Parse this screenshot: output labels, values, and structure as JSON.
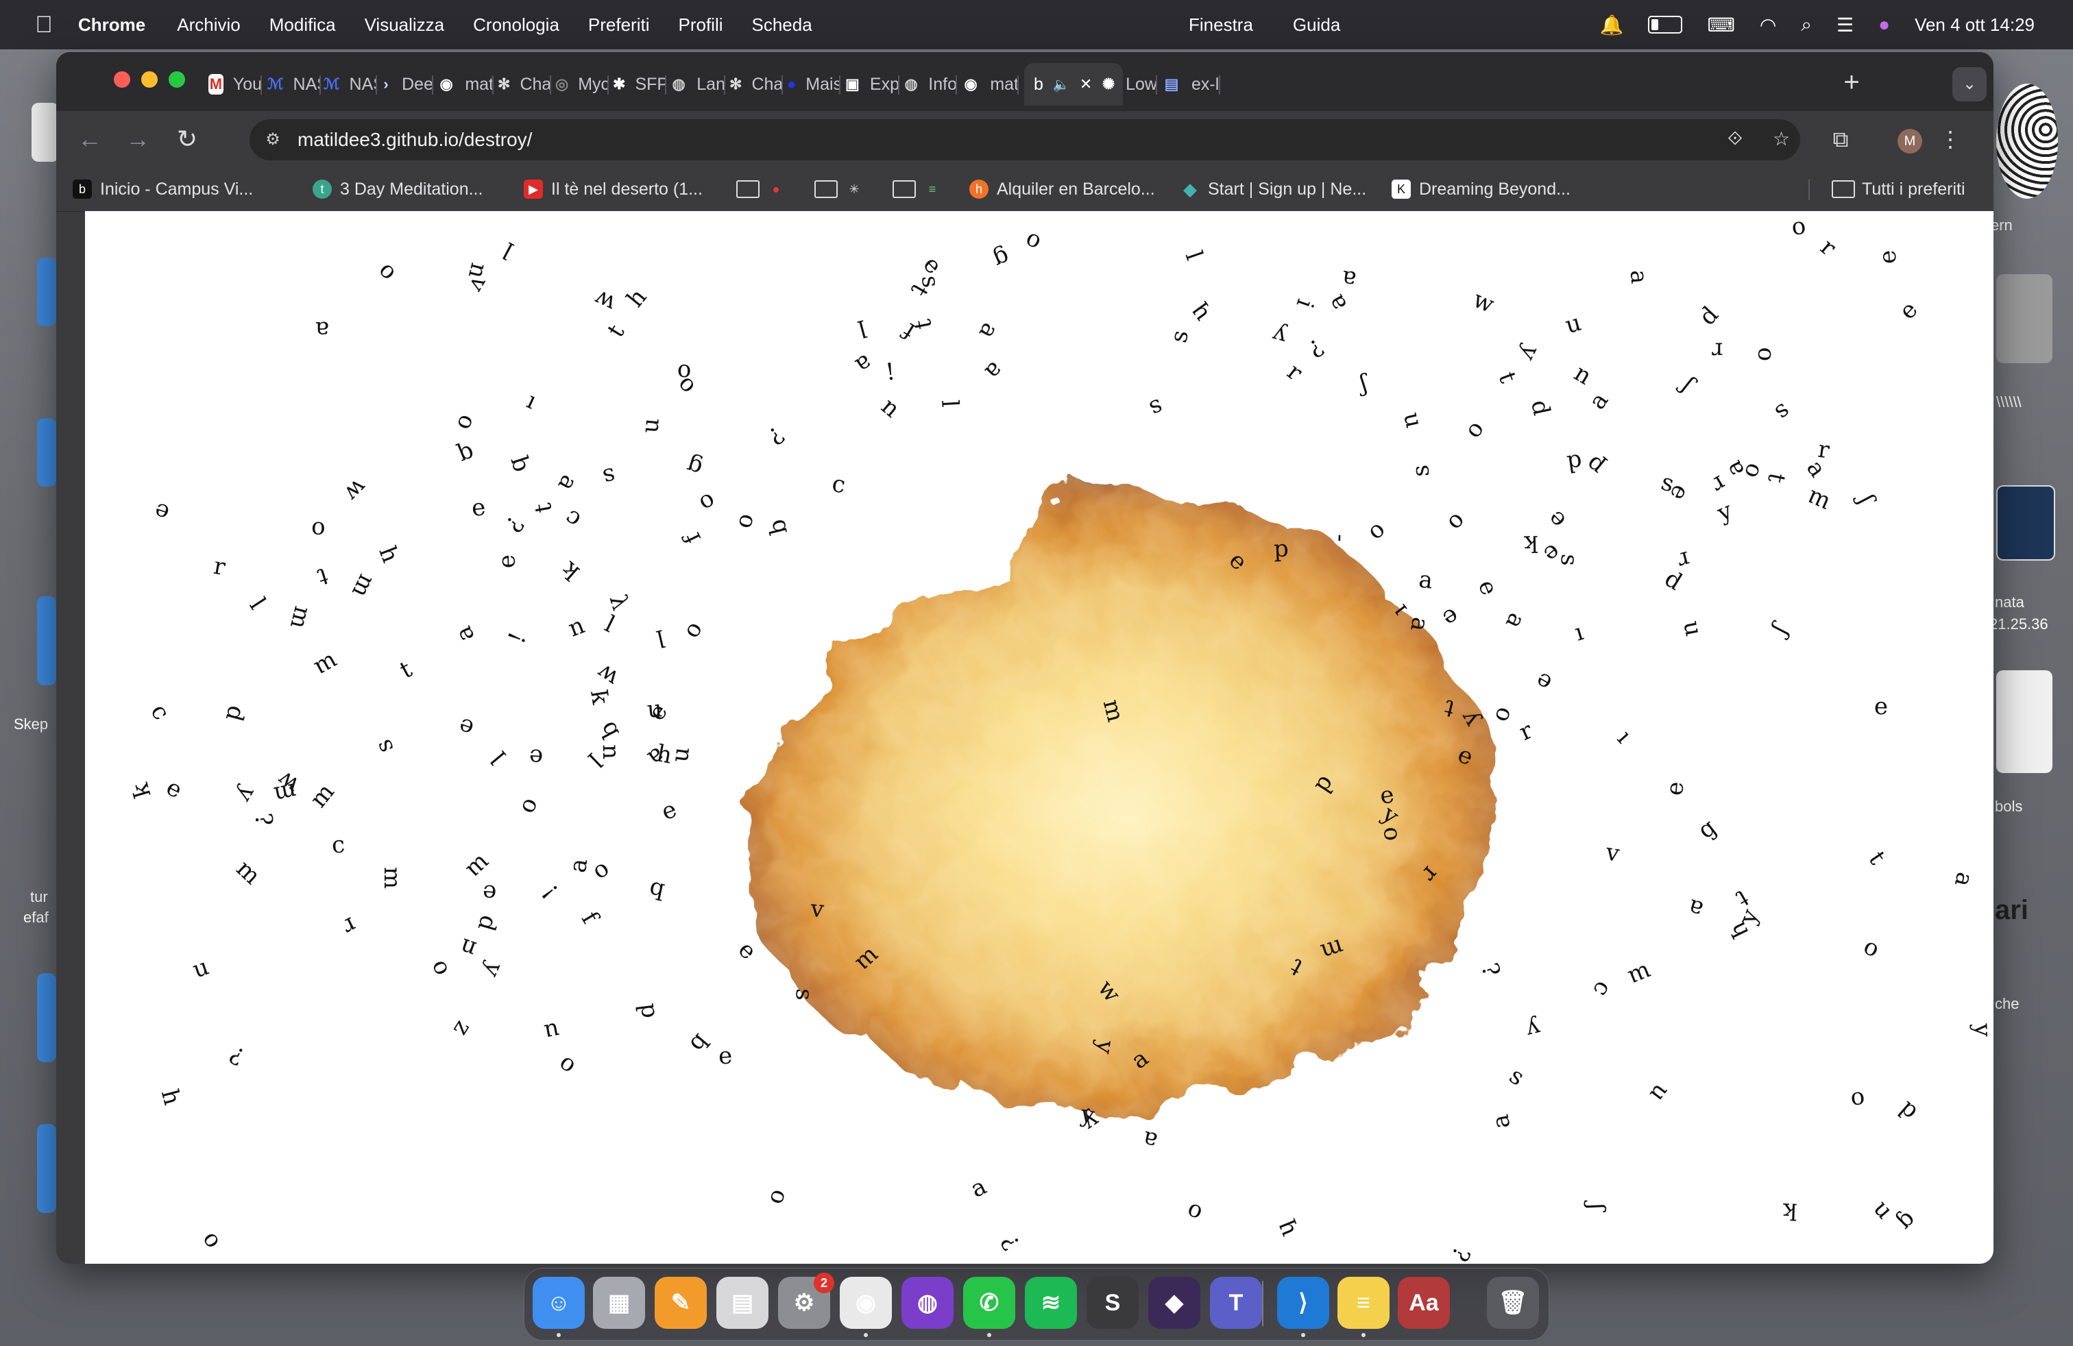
{
  "menubar": {
    "app_name": "Chrome",
    "items": [
      "Archivio",
      "Modifica",
      "Visualizza",
      "Cronologia",
      "Preferiti",
      "Profili",
      "Scheda"
    ],
    "items_mid": [
      "Finestra",
      "Guida"
    ],
    "clock": "Ven 4 ott  14:29"
  },
  "desktop": {
    "labels": [
      "Skep",
      "tur",
      "efaf",
      "ern",
      "nata",
      "21.25.36",
      "bols",
      "ari",
      "che",
      "\\\\\\\\\\\\"
    ]
  },
  "tabs": [
    {
      "label": "You",
      "icon": "gmail-icon"
    },
    {
      "label": "NAS",
      "icon": "nas-icon"
    },
    {
      "label": "NAS",
      "icon": "nas-icon"
    },
    {
      "label": "Dee",
      "icon": "deepl-icon"
    },
    {
      "label": "mat",
      "icon": "github-icon"
    },
    {
      "label": "Cha",
      "icon": "chatgpt-icon"
    },
    {
      "label": "Myc",
      "icon": "site-icon"
    },
    {
      "label": "SFP",
      "icon": "asterisk-icon"
    },
    {
      "label": "Lan",
      "icon": "globe-icon"
    },
    {
      "label": "Cha",
      "icon": "chatgpt-icon"
    },
    {
      "label": "Mais",
      "icon": "blue-dot-icon"
    },
    {
      "label": "Exp",
      "icon": "square-icon"
    },
    {
      "label": "Info",
      "icon": "globe-icon"
    },
    {
      "label": "mat",
      "icon": "github-icon"
    },
    {
      "label": "b",
      "icon": "speaker-icon",
      "active": true
    },
    {
      "label": "Low",
      "icon": "sun-icon"
    },
    {
      "label": "ex-l",
      "icon": "grid-icon"
    }
  ],
  "toolbar": {
    "url": "matildee3.github.io/destroy/",
    "profile_initial": "M"
  },
  "bookmarks": [
    {
      "label": "Inicio - Campus Vi...",
      "icon": "b"
    },
    {
      "label": "3 Day Meditation...",
      "icon": "t"
    },
    {
      "label": "Il tè nel deserto (1...",
      "icon": "▶"
    },
    {
      "label": "",
      "icon": "folder"
    },
    {
      "label": "",
      "icon": "folder"
    },
    {
      "label": "",
      "icon": "folder"
    },
    {
      "label": "Alquiler en Barcelo...",
      "icon": "h"
    },
    {
      "label": "Start | Sign up | Ne...",
      "icon": "◆"
    },
    {
      "label": "Dreaming Beyond...",
      "icon": "K"
    },
    {
      "label": "Tutti i preferiti",
      "icon": "folder"
    }
  ],
  "page": {
    "letters": [
      [
        "a",
        460,
        470,
        0
      ],
      [
        "o",
        556,
        384,
        180
      ],
      [
        "n",
        686,
        384,
        190
      ],
      [
        "v",
        688,
        404,
        160
      ],
      [
        "l",
        736,
        354,
        200
      ],
      [
        "w",
        868,
        428,
        150
      ],
      [
        "t",
        892,
        472,
        200
      ],
      [
        "h",
        918,
        424,
        160
      ],
      [
        "e",
        1350,
        376,
        210
      ],
      [
        "s",
        1348,
        400,
        200
      ],
      [
        "t",
        1334,
        412,
        190
      ],
      [
        "g",
        1450,
        366,
        180
      ],
      [
        "o",
        1498,
        338,
        0
      ],
      [
        "l",
        1736,
        362,
        0
      ],
      [
        "a",
        1432,
        472,
        0
      ],
      [
        "l",
        1252,
        468,
        0
      ],
      [
        "f",
        1320,
        472,
        0
      ],
      [
        "t",
        1340,
        462,
        0
      ],
      [
        "a",
        1250,
        520,
        200
      ],
      [
        "!",
        1292,
        532,
        0
      ],
      [
        "n",
        1288,
        584,
        0
      ],
      [
        "l",
        1380,
        578,
        0
      ],
      [
        "a",
        1440,
        530,
        0
      ],
      [
        "o",
        988,
        528,
        180
      ],
      [
        "o",
        990,
        552,
        0
      ],
      [
        "u",
        938,
        610,
        0
      ],
      [
        "¿",
        1120,
        622,
        0
      ],
      [
        "c",
        1214,
        696,
        0
      ],
      [
        "b",
        1124,
        758,
        200
      ],
      [
        "o",
        1080,
        750,
        0
      ],
      [
        "o",
        1022,
        722,
        0
      ],
      [
        "g",
        1002,
        670,
        0
      ],
      [
        "f",
        1004,
        774,
        0
      ],
      [
        "o",
        666,
        604,
        0
      ],
      [
        "b",
        668,
        648,
        0
      ],
      [
        "ı",
        770,
        574,
        0
      ],
      [
        "b",
        748,
        666,
        0
      ],
      [
        "a",
        818,
        694,
        0
      ],
      [
        "s",
        880,
        684,
        0
      ],
      [
        "c",
        826,
        746,
        0
      ],
      [
        "t",
        786,
        730,
        0
      ],
      [
        "¿",
        738,
        752,
        0
      ],
      [
        "e",
        688,
        730,
        0
      ],
      [
        "ʞ",
        824,
        818,
        0
      ],
      [
        "ə",
        734,
        808,
        0
      ],
      [
        "w",
        504,
        704,
        0
      ],
      [
        "o",
        454,
        762,
        0
      ],
      [
        "h",
        556,
        798,
        200
      ],
      [
        "m",
        514,
        844,
        200
      ],
      [
        "t",
        464,
        830,
        200
      ],
      [
        "r",
        312,
        816,
        0
      ],
      [
        "l",
        370,
        870,
        0
      ],
      [
        "m",
        422,
        890,
        0
      ],
      [
        "ɯ",
        460,
        960,
        0
      ],
      [
        "e",
        226,
        736,
        0
      ],
      [
        "a",
        668,
        914,
        0
      ],
      [
        "!",
        748,
        920,
        0
      ],
      [
        "n",
        830,
        904,
        0
      ],
      [
        "l",
        884,
        900,
        0
      ],
      [
        "λ",
        892,
        868,
        0
      ],
      [
        "o",
        1004,
        910,
        0
      ],
      [
        "l",
        958,
        920,
        0
      ],
      [
        "w",
        872,
        974,
        0
      ],
      [
        "ʞ",
        860,
        1008,
        0
      ],
      [
        "e",
        950,
        1028,
        0
      ],
      [
        "u",
        944,
        1024,
        0
      ],
      [
        "b",
        878,
        1054,
        200
      ],
      [
        "n",
        880,
        1086,
        0
      ],
      [
        "l",
        862,
        1098,
        0
      ],
      [
        "e",
        772,
        1094,
        0
      ],
      [
        "l",
        722,
        1094,
        0
      ],
      [
        "u",
        982,
        1090,
        0
      ],
      [
        "ɐ",
        944,
        1090,
        0
      ],
      [
        "h",
        958,
        1090,
        0
      ],
      [
        "c",
        224,
        1028,
        0
      ],
      [
        "d",
        332,
        1030,
        0
      ],
      [
        "ʇ",
        588,
        970,
        0
      ],
      [
        "e",
        670,
        1050,
        0
      ],
      [
        "s",
        552,
        1078,
        0
      ],
      [
        "o",
        760,
        1164,
        0
      ],
      [
        "e",
        966,
        1172,
        0
      ],
      [
        "e",
        244,
        1140,
        0
      ],
      [
        "ʞ",
        200,
        1140,
        0
      ],
      [
        "y",
        350,
        1148,
        0
      ],
      [
        "m",
        400,
        1146,
        0
      ],
      [
        "w",
        406,
        1130,
        0
      ],
      [
        "¿",
        372,
        1186,
        0
      ],
      [
        "m",
        454,
        1150,
        0
      ],
      [
        "c",
        484,
        1222,
        0
      ],
      [
        "m",
        346,
        1262,
        0
      ],
      [
        "m",
        556,
        1270,
        0
      ],
      [
        "ɯ",
        682,
        1254,
        0
      ],
      [
        "e",
        704,
        1292,
        0
      ],
      [
        "!",
        796,
        1290,
        0
      ],
      [
        "a",
        834,
        1252,
        0
      ],
      [
        "o",
        866,
        1258,
        0
      ],
      [
        "q",
        948,
        1284,
        0
      ],
      [
        "f",
        854,
        1328,
        0
      ],
      [
        "d",
        700,
        1336,
        0
      ],
      [
        "r",
        502,
        1340,
        0
      ],
      [
        "n",
        672,
        1372,
        0
      ],
      [
        "o",
        630,
        1402,
        0
      ],
      [
        "ʎ",
        706,
        1402,
        0
      ],
      [
        "u",
        282,
        1402,
        0
      ],
      [
        "¿",
        338,
        1526,
        0
      ],
      [
        "h",
        238,
        1590,
        0
      ],
      [
        "z",
        666,
        1490,
        0
      ],
      [
        "u",
        794,
        1494,
        0
      ],
      [
        "o",
        816,
        1544,
        0
      ],
      [
        "d",
        932,
        1464,
        0
      ],
      [
        "q",
        1006,
        1508,
        0
      ],
      [
        "e",
        1048,
        1530,
        0
      ],
      [
        "e",
        1080,
        1376,
        0
      ],
      [
        "s",
        1164,
        1440,
        0
      ],
      [
        "ɯ",
        1250,
        1390,
        0
      ],
      [
        "ʌ",
        1182,
        1320,
        0
      ],
      [
        "ʍ",
        1600,
        1438,
        0
      ],
      [
        "ʎ",
        1598,
        1516,
        0
      ],
      [
        "ʎ",
        1580,
        1622,
        0
      ],
      [
        "ɐ",
        1668,
        1648,
        0
      ],
      [
        "¿",
        1468,
        1800,
        0
      ],
      [
        "o",
        1126,
        1736,
        0
      ],
      [
        "ɐ",
        1420,
        1726,
        0
      ],
      [
        "o",
        1732,
        1758,
        0
      ],
      [
        "ɥ",
        1864,
        1782,
        0
      ],
      [
        "¿",
        2118,
        1818,
        0
      ],
      [
        "ɯ",
        1926,
        1370,
        0
      ],
      [
        "ʇ",
        1886,
        1396,
        0
      ],
      [
        "m",
        1608,
        1026,
        0
      ],
      [
        "d",
        1922,
        1134,
        0
      ],
      [
        "ə",
        2014,
        1154,
        0
      ],
      [
        "ʎ",
        2016,
        1182,
        0
      ],
      [
        "o",
        2016,
        1206,
        0
      ],
      [
        "ɹ",
        2074,
        1262,
        0
      ],
      [
        "p",
        1858,
        790,
        0
      ],
      [
        "e",
        1796,
        808,
        0
      ],
      [
        "-",
        1950,
        774,
        0
      ],
      [
        "o",
        2000,
        766,
        0
      ],
      [
        "ɐ",
        2070,
        840,
        0
      ],
      [
        "ı",
        2036,
        880,
        0
      ],
      [
        "ɐ",
        2056,
        900,
        0
      ],
      [
        "ə",
        2104,
        886,
        0
      ],
      [
        "ʇ",
        2108,
        1018,
        0
      ],
      [
        "ʎ",
        2138,
        1036,
        0
      ],
      [
        "o",
        2184,
        1032,
        0
      ],
      [
        "ɹ",
        2220,
        1060,
        0
      ],
      [
        "ə",
        2126,
        1096,
        0
      ],
      [
        "ə",
        2156,
        848,
        0
      ],
      [
        "ɐ",
        2196,
        894,
        0
      ],
      [
        "ı",
        2298,
        912,
        0
      ],
      [
        "ə",
        2244,
        980,
        0
      ],
      [
        "u",
        2050,
        602,
        0
      ],
      [
        "o",
        2144,
        618,
        0
      ],
      [
        "ʃ",
        1984,
        552,
        0
      ],
      [
        "ɹ",
        1878,
        536,
        0
      ],
      [
        "s",
        2064,
        676,
        0
      ],
      [
        "o",
        2112,
        748,
        0
      ],
      [
        "ʞ",
        2222,
        778,
        0
      ],
      [
        "ə",
        2264,
        744,
        0
      ],
      [
        "s",
        2280,
        806,
        0
      ],
      [
        "e",
        2254,
        796,
        0
      ],
      [
        "a",
        1958,
        396,
        0
      ],
      [
        "ɥ",
        1738,
        446,
        0
      ],
      [
        "s",
        1712,
        480,
        0
      ],
      [
        "¿",
        1908,
        494,
        0
      ],
      [
        "ʎ",
        1858,
        474,
        0
      ],
      [
        "ɐ",
        1944,
        428,
        0
      ],
      [
        "i",
        1898,
        432,
        0
      ],
      [
        "s",
        1678,
        584,
        0
      ],
      [
        "ʍ",
        2148,
        434,
        0
      ],
      [
        "ʇ",
        2188,
        542,
        0
      ],
      [
        "ʎ",
        2218,
        502,
        0
      ],
      [
        "u",
        2284,
        462,
        0
      ],
      [
        "n",
        2298,
        536,
        0
      ],
      [
        "d",
        2236,
        584,
        0
      ],
      [
        "ɐ",
        2326,
        576,
        0
      ],
      [
        "d",
        2286,
        664,
        0
      ],
      [
        "p",
        2316,
        668,
        0
      ],
      [
        "ɐ",
        2376,
        394,
        0
      ],
      [
        "d",
        2482,
        450,
        0
      ],
      [
        "ɹ",
        2496,
        496,
        0
      ],
      [
        "ʃ",
        2458,
        550,
        0
      ],
      [
        "o",
        2566,
        506,
        0
      ],
      [
        "s",
        2592,
        590,
        0
      ],
      [
        "ɹ",
        2652,
        650,
        0
      ],
      [
        "ɐ",
        2636,
        676,
        0
      ],
      [
        "ʇ",
        2580,
        686,
        0
      ],
      [
        "ɹ",
        2496,
        692,
        0
      ],
      [
        "s",
        2424,
        694,
        0
      ],
      [
        "ɐ",
        2524,
        670,
        0
      ],
      [
        "o",
        2548,
        676,
        0
      ],
      [
        "ʎ",
        2508,
        740,
        0
      ],
      [
        "ɯ",
        2636,
        720,
        0
      ],
      [
        "ʃ",
        2714,
        718,
        0
      ],
      [
        "ə",
        2436,
        706,
        0
      ],
      [
        "ɹ",
        2446,
        802,
        0
      ],
      [
        "d",
        2430,
        836,
        0
      ],
      [
        "u",
        2458,
        906,
        0
      ],
      [
        "ʃ",
        2594,
        910,
        0
      ],
      [
        "o",
        2614,
        324,
        0
      ],
      [
        "ɹ",
        2656,
        354,
        0
      ],
      [
        "e",
        2744,
        364,
        0
      ],
      [
        "e",
        2774,
        442,
        0
      ],
      [
        "e",
        2734,
        1020,
        0
      ],
      [
        "ı",
        2364,
        1064,
        0
      ],
      [
        "ə",
        2438,
        1140,
        0
      ],
      [
        "ɓ",
        2482,
        1202,
        0
      ],
      [
        "ʌ",
        2342,
        1238,
        0
      ],
      [
        "ʇ",
        2728,
        1244,
        0
      ],
      [
        "ɐ",
        2850,
        1272,
        0
      ],
      [
        "ʇ",
        2532,
        1296,
        0
      ],
      [
        "ɐ",
        2464,
        1310,
        0
      ],
      [
        "ɥ",
        2530,
        1344,
        0
      ],
      [
        "ʎ",
        2546,
        1328,
        0
      ],
      [
        "ɯ",
        2376,
        1412,
        0
      ],
      [
        "o",
        2718,
        1376,
        0
      ],
      [
        "¿",
        2162,
        1406,
        0
      ],
      [
        "ɔ",
        2324,
        1430,
        0
      ],
      [
        "ʎ",
        2226,
        1486,
        0
      ],
      [
        "s",
        2204,
        1560,
        0
      ],
      [
        "ɐ",
        2184,
        1624,
        0
      ],
      [
        "u",
        2410,
        1584,
        0
      ],
      [
        "o",
        2700,
        1594,
        0
      ],
      [
        "d",
        2772,
        1610,
        0
      ],
      [
        "ʎ",
        2878,
        1492,
        0
      ],
      [
        "ɓ",
        2768,
        1768,
        0
      ],
      [
        "ʞ",
        2600,
        1752,
        0
      ],
      [
        "u",
        2736,
        1754,
        0
      ],
      [
        "ʃ",
        2324,
        1750,
        0
      ],
      [
        "ɐ",
        1656,
        1538,
        0
      ],
      [
        "ʎ",
        1576,
        1620,
        0
      ],
      [
        "o",
        296,
        1800,
        0
      ]
    ]
  },
  "dock": [
    {
      "name": "finder",
      "label": "☺",
      "color": "#3f8ff0"
    },
    {
      "name": "launchpad",
      "label": "▦",
      "color": "#a7a9b0"
    },
    {
      "name": "pages",
      "label": "✎",
      "color": "#f39b2a"
    },
    {
      "name": "calculator",
      "label": "▤",
      "color": "#d7d7d9"
    },
    {
      "name": "system-settings",
      "label": "⚙",
      "color": "#8d8e93",
      "badge": "2"
    },
    {
      "name": "chrome",
      "label": "◉",
      "color": "#e9e9ea"
    },
    {
      "name": "firefox",
      "label": "◍",
      "color": "#7b3ecb"
    },
    {
      "name": "whatsapp",
      "label": "✆",
      "color": "#27c44a"
    },
    {
      "name": "spotify",
      "label": "≋",
      "color": "#1db954"
    },
    {
      "name": "sublime",
      "label": "S",
      "color": "#3a3a3c"
    },
    {
      "name": "obsidian",
      "label": "◆",
      "color": "#3b2a57"
    },
    {
      "name": "teams",
      "label": "T",
      "color": "#5b5fc7"
    },
    {
      "name": "vscode",
      "label": "⟩",
      "color": "#1f7ad6"
    },
    {
      "name": "notes",
      "label": "≡",
      "color": "#f4d04c"
    },
    {
      "name": "dictionary",
      "label": "Aa",
      "color": "#b23a3a"
    },
    {
      "name": "trash",
      "label": "🗑",
      "color": "#5a5b60"
    }
  ]
}
